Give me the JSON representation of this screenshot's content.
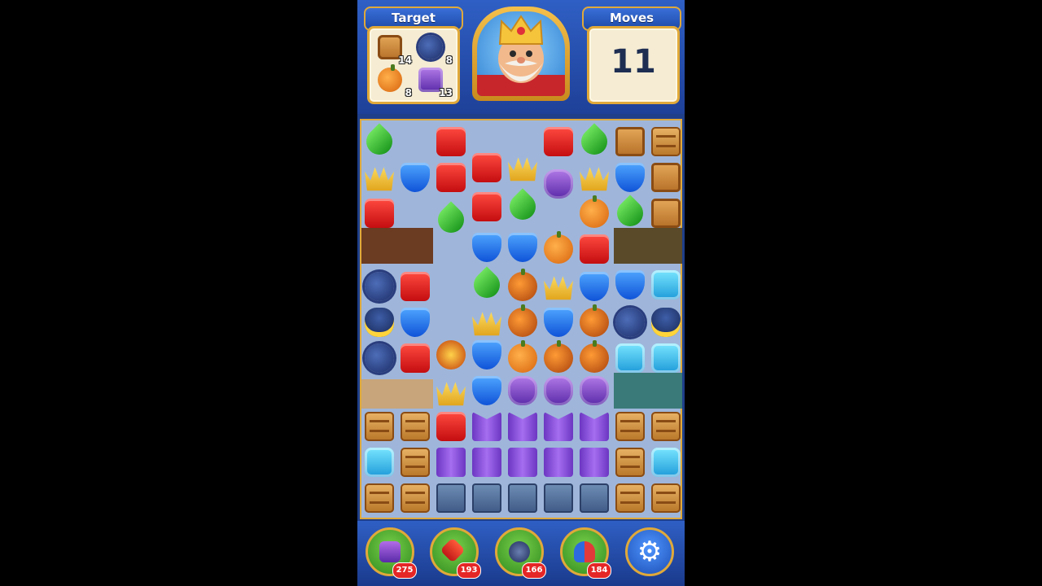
{
  "header": {
    "target_label": "Target",
    "moves_label": "Moves",
    "moves_value": "11",
    "targets": [
      {
        "name": "box",
        "count": "14"
      },
      {
        "name": "mine",
        "count": "8"
      },
      {
        "name": "pumpkin",
        "count": "8"
      },
      {
        "name": "vase",
        "count": "13"
      }
    ]
  },
  "boosters": [
    {
      "name": "hammer-icon",
      "count": "275"
    },
    {
      "name": "arrow-icon",
      "count": "193"
    },
    {
      "name": "cannon-icon",
      "count": "166"
    },
    {
      "name": "jester-hat-icon",
      "count": "184"
    }
  ],
  "settings_icon": "gear-icon",
  "colors": {
    "frame": "#e0a93a",
    "header": "#2f5fc4",
    "board": "#9fb6da"
  }
}
